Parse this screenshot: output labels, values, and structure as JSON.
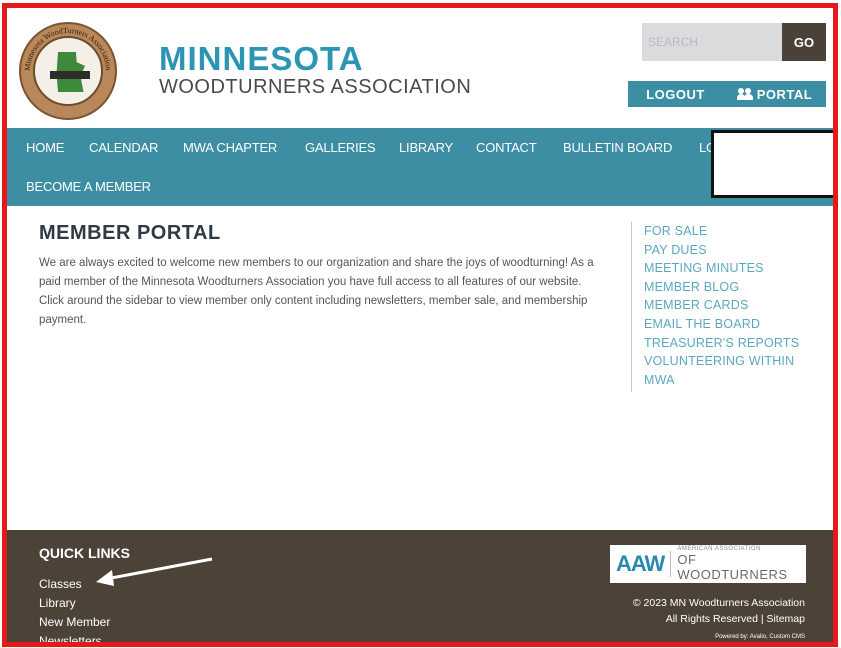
{
  "header": {
    "brand_title": "MINNESOTA",
    "brand_subtitle": "WOODTURNERS ASSOCIATION",
    "logo_ring_text": "Minnesota WoodTurners Association",
    "search_placeholder": "SEARCH",
    "go_label": "GO",
    "logout_label": "LOGOUT",
    "portal_label": "PORTAL"
  },
  "nav": {
    "items": [
      "HOME",
      "CALENDAR",
      "MWA CHAPTER",
      "GALLERIES",
      "LIBRARY",
      "CONTACT",
      "BULLETIN BOARD",
      "LO"
    ],
    "second_row": "BECOME A MEMBER"
  },
  "main": {
    "title": "MEMBER PORTAL",
    "intro": "We are always excited to welcome new members to our organization and share the joys of woodturning! As a paid member of the Minnesota Woodturners Association you have full access to all features of our website. Click around the sidebar to view member only content including newsletters, member sale, and membership payment."
  },
  "sidebar": {
    "links": [
      "FOR SALE",
      "PAY DUES",
      "MEETING MINUTES",
      "MEMBER BLOG",
      "MEMBER CARDS",
      "EMAIL THE BOARD",
      "TREASURER'S REPORTS",
      "VOLUNTEERING WITHIN",
      "MWA"
    ]
  },
  "footer": {
    "quick_links_title": "QUICK LINKS",
    "quick_links": [
      "Classes",
      "Library",
      "New Member",
      "Newsletters"
    ],
    "aaw_mark": "AAW",
    "aaw_small": "AMERICAN ASSOCIATION",
    "aaw_big": "OF WOODTURNERS",
    "copyright_line1": "© 2023 MN Woodturners Association",
    "copyright_line2": "All Rights Reserved | Sitemap",
    "powered_by": "Powered by: Avalio, Custom CMS"
  },
  "colors": {
    "frame": "#e3191b",
    "brand": "#2c95b4",
    "nav_bg": "#3d8ea3",
    "footer_bg": "#4d4238",
    "sidebar_link": "#5aa8be"
  }
}
